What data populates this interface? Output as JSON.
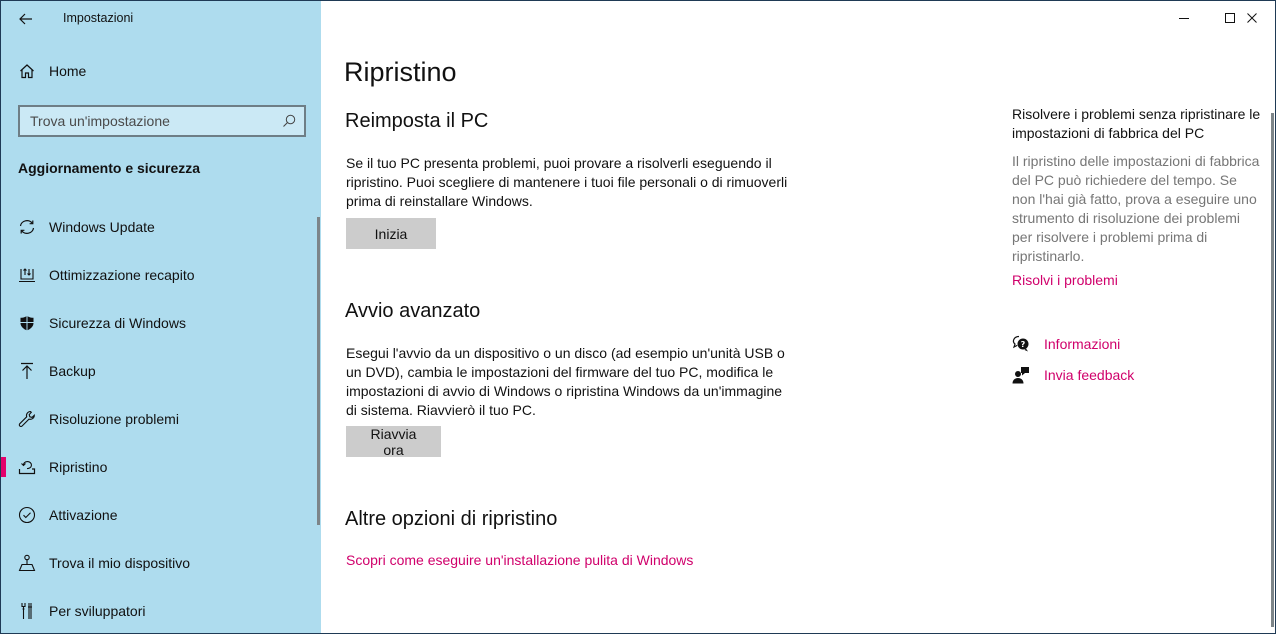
{
  "window": {
    "title": "Impostazioni",
    "controls": {
      "minimize": "minimize",
      "maximize": "maximize",
      "close": "close"
    }
  },
  "sidebar": {
    "home_label": "Home",
    "search": {
      "placeholder": "Trova un'impostazione",
      "value": ""
    },
    "section_title": "Aggiornamento e sicurezza",
    "items": [
      {
        "label": "Windows Update",
        "icon": "sync-icon",
        "active": false
      },
      {
        "label": "Ottimizzazione recapito",
        "icon": "delivery-optimization-icon",
        "active": false
      },
      {
        "label": "Sicurezza di Windows",
        "icon": "shield-icon",
        "active": false
      },
      {
        "label": "Backup",
        "icon": "backup-upload-icon",
        "active": false
      },
      {
        "label": "Risoluzione problemi",
        "icon": "wrench-icon",
        "active": false
      },
      {
        "label": "Ripristino",
        "icon": "recovery-icon",
        "active": true
      },
      {
        "label": "Attivazione",
        "icon": "check-circle-icon",
        "active": false
      },
      {
        "label": "Trova il mio dispositivo",
        "icon": "find-device-icon",
        "active": false
      },
      {
        "label": "Per sviluppatori",
        "icon": "developer-tools-icon",
        "active": false
      }
    ]
  },
  "main": {
    "page_title": "Ripristino",
    "sections": {
      "reset": {
        "title": "Reimposta il PC",
        "description": "Se il tuo PC presenta problemi, puoi provare a risolverli eseguendo il ripristino. Puoi scegliere di mantenere i tuoi file personali o di rimuoverli prima di reinstallare Windows.",
        "button_label": "Inizia"
      },
      "advanced": {
        "title": "Avvio avanzato",
        "description": "Esegui l'avvio da un dispositivo o un disco (ad esempio un'unità USB o un DVD), cambia le impostazioni del firmware del tuo PC, modifica le impostazioni di avvio di Windows o ripristina Windows da un'immagine di sistema. Riavvierò il tuo PC.",
        "button_label": "Riavvia ora"
      },
      "other": {
        "title": "Altre opzioni di ripristino",
        "link_label": "Scopri come eseguire un'installazione pulita di Windows"
      }
    },
    "aside": {
      "title": "Risolvere i problemi senza ripristinare le impostazioni di fabbrica del PC",
      "text": "Il ripristino delle impostazioni di fabbrica del PC può richiedere del tempo. Se non l'hai già fatto, prova a eseguire uno strumento di risoluzione dei problemi per risolvere i problemi prima di ripristinarlo.",
      "link_label": "Risolvi i problemi"
    },
    "help": {
      "info_label": "Informazioni",
      "feedback_label": "Invia feedback"
    }
  },
  "colors": {
    "sidebar_bg": "#aedcee",
    "accent": "#e3006b",
    "link": "#d0006b",
    "button_bg": "#cccccc",
    "muted_text": "#767676"
  }
}
